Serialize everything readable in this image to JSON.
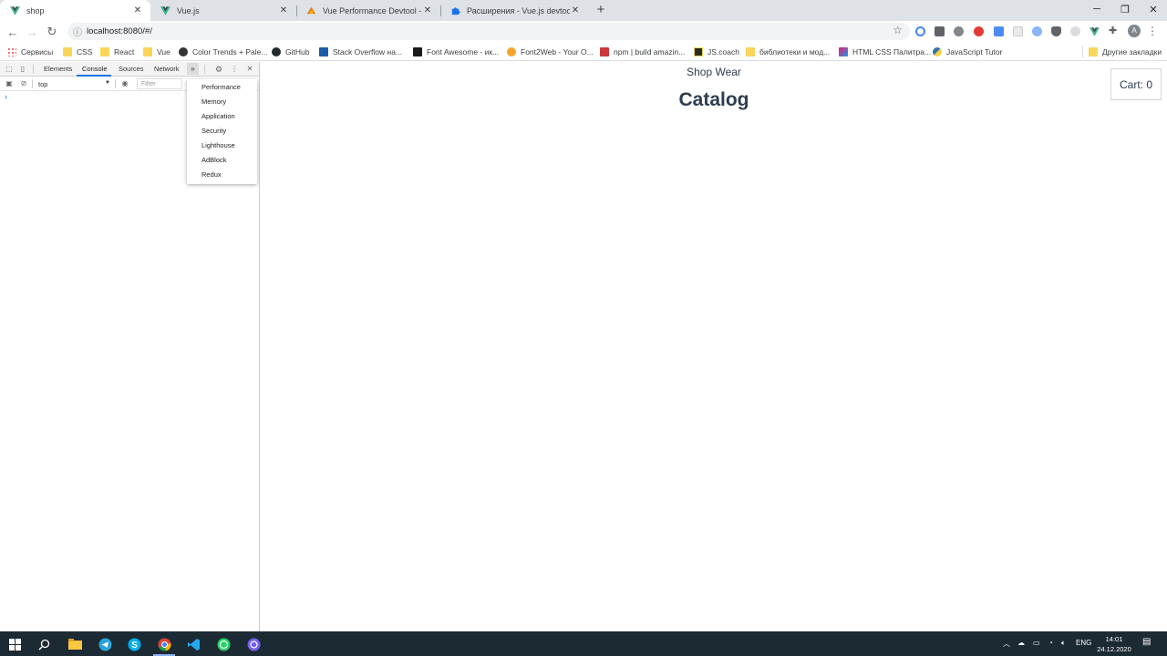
{
  "browser": {
    "tabs": [
      {
        "title": "shop",
        "favicon": "vue-icon",
        "active": true
      },
      {
        "title": "Vue.js",
        "favicon": "vue-icon",
        "active": false
      },
      {
        "title": "Vue Performance Devtool - Инте",
        "favicon": "vue-devtool-icon",
        "active": false
      },
      {
        "title": "Расширения - Vue.js devtools",
        "favicon": "puzzle-icon",
        "active": false
      }
    ],
    "new_tab_label": "+",
    "url": "localhost:8080/#/",
    "avatar_initial": "A",
    "bookmarks": [
      {
        "label": "Сервисы",
        "icon": "apps-icon"
      },
      {
        "label": "CSS",
        "icon": "folder-icon"
      },
      {
        "label": "React",
        "icon": "folder-icon"
      },
      {
        "label": "Vue",
        "icon": "folder-icon"
      },
      {
        "label": "Color Trends + Pale...",
        "icon": "palette-icon"
      },
      {
        "label": "GitHub",
        "icon": "github-icon"
      },
      {
        "label": "Stack Overflow на...",
        "icon": "stackoverflow-icon"
      },
      {
        "label": "Font Awesome - ик...",
        "icon": "fontawesome-icon"
      },
      {
        "label": "Font2Web - Your O...",
        "icon": "font2web-icon"
      },
      {
        "label": "npm | build amazin...",
        "icon": "npm-icon"
      },
      {
        "label": "JS.coach",
        "icon": "jscoach-icon"
      },
      {
        "label": "библиотеки и мод...",
        "icon": "folder-icon"
      },
      {
        "label": "HTML CSS Палитра...",
        "icon": "palette-icon"
      },
      {
        "label": "JavaScript Tutor",
        "icon": "python-icon"
      }
    ],
    "other_bookmarks": "Другие закладки"
  },
  "devtools": {
    "tabs": [
      "Elements",
      "Console",
      "Sources",
      "Network"
    ],
    "active_tab": "Console",
    "more_label": "»",
    "context": "top",
    "filter_placeholder": "Filter",
    "prompt": "›",
    "more_menu": [
      "Performance",
      "Memory",
      "Application",
      "Security",
      "Lighthouse",
      "AdBlock",
      "Redux"
    ]
  },
  "page": {
    "brand": "Shop Wear",
    "heading": "Catalog",
    "cart": "Cart: 0"
  },
  "taskbar": {
    "language": "ENG",
    "time": "14:01",
    "date": "24.12.2020"
  }
}
